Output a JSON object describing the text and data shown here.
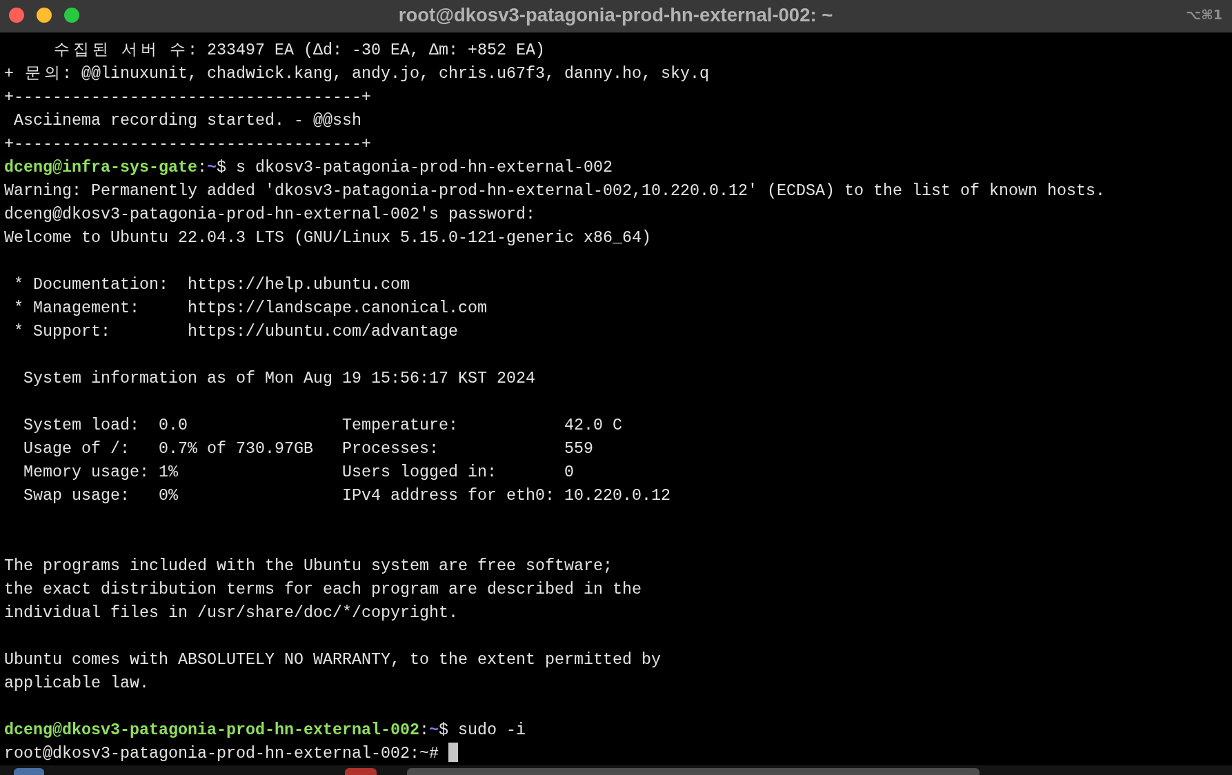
{
  "window": {
    "title": "root@dkosv3-patagonia-prod-hn-external-002: ~",
    "shortcut": "⌥⌘1"
  },
  "terminal": {
    "lines": [
      {
        "kind": "output",
        "text": "     수집된 서버 수: 233497 EA (Δd: -30 EA, Δm: +852 EA)"
      },
      {
        "kind": "output",
        "text": "+ 문의: @@linuxunit, chadwick.kang, andy.jo, chris.u67f3, danny.ho, sky.q"
      },
      {
        "kind": "output",
        "text": "+------------------------------------+"
      },
      {
        "kind": "output",
        "text": " Asciinema recording started. - @@ssh"
      },
      {
        "kind": "output",
        "text": "+------------------------------------+"
      },
      {
        "kind": "prompt",
        "user_host": "dceng@infra-sys-gate",
        "separator": ":",
        "path": "~",
        "symbol": "$",
        "command": "s dkosv3-patagonia-prod-hn-external-002"
      },
      {
        "kind": "output",
        "text": "Warning: Permanently added 'dkosv3-patagonia-prod-hn-external-002,10.220.0.12' (ECDSA) to the list of known hosts."
      },
      {
        "kind": "output",
        "text": "dceng@dkosv3-patagonia-prod-hn-external-002's password:"
      },
      {
        "kind": "output",
        "text": "Welcome to Ubuntu 22.04.3 LTS (GNU/Linux 5.15.0-121-generic x86_64)"
      },
      {
        "kind": "blank"
      },
      {
        "kind": "output",
        "text": " * Documentation:  https://help.ubuntu.com"
      },
      {
        "kind": "output",
        "text": " * Management:     https://landscape.canonical.com"
      },
      {
        "kind": "output",
        "text": " * Support:        https://ubuntu.com/advantage"
      },
      {
        "kind": "blank"
      },
      {
        "kind": "output",
        "text": "  System information as of Mon Aug 19 15:56:17 KST 2024"
      },
      {
        "kind": "blank"
      },
      {
        "kind": "output",
        "text": "  System load:  0.0                Temperature:           42.0 C"
      },
      {
        "kind": "output",
        "text": "  Usage of /:   0.7% of 730.97GB   Processes:             559"
      },
      {
        "kind": "output",
        "text": "  Memory usage: 1%                 Users logged in:       0"
      },
      {
        "kind": "output",
        "text": "  Swap usage:   0%                 IPv4 address for eth0: 10.220.0.12"
      },
      {
        "kind": "blank"
      },
      {
        "kind": "blank"
      },
      {
        "kind": "output",
        "text": "The programs included with the Ubuntu system are free software;"
      },
      {
        "kind": "output",
        "text": "the exact distribution terms for each program are described in the"
      },
      {
        "kind": "output",
        "text": "individual files in /usr/share/doc/*/copyright."
      },
      {
        "kind": "blank"
      },
      {
        "kind": "output",
        "text": "Ubuntu comes with ABSOLUTELY NO WARRANTY, to the extent permitted by"
      },
      {
        "kind": "output",
        "text": "applicable law."
      },
      {
        "kind": "blank"
      },
      {
        "kind": "prompt",
        "user_host": "dceng@dkosv3-patagonia-prod-hn-external-002",
        "separator": ":",
        "path": "~",
        "symbol": "$",
        "command": "sudo -i"
      },
      {
        "kind": "active",
        "text": "root@dkosv3-patagonia-prod-hn-external-002:~#",
        "cursor": true
      }
    ]
  }
}
